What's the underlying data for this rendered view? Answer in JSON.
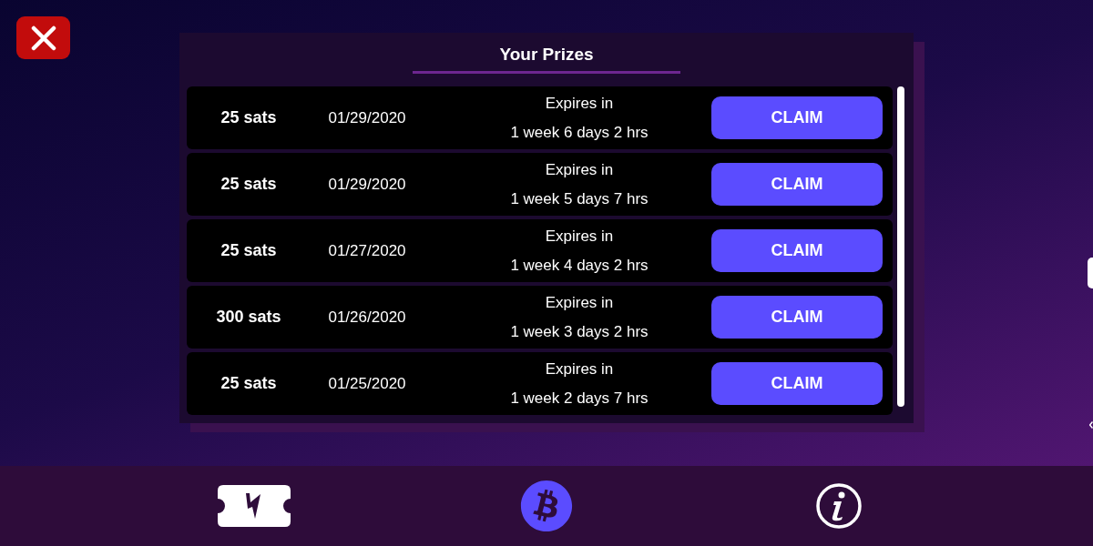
{
  "panel": {
    "title": "Your Prizes"
  },
  "prizes": [
    {
      "amount": "25 sats",
      "date": "01/29/2020",
      "expires_label": "Expires in",
      "expires": "1 week 6 days 2 hrs",
      "button": "CLAIM"
    },
    {
      "amount": "25 sats",
      "date": "01/29/2020",
      "expires_label": "Expires in",
      "expires": "1 week 5 days 7 hrs",
      "button": "CLAIM"
    },
    {
      "amount": "25 sats",
      "date": "01/27/2020",
      "expires_label": "Expires in",
      "expires": "1 week 4 days 2 hrs",
      "button": "CLAIM"
    },
    {
      "amount": "300 sats",
      "date": "01/26/2020",
      "expires_label": "Expires in",
      "expires": "1 week 3 days 2 hrs",
      "button": "CLAIM"
    },
    {
      "amount": "25 sats",
      "date": "01/25/2020",
      "expires_label": "Expires in",
      "expires": "1 week 2 days 7 hrs",
      "button": "CLAIM"
    }
  ],
  "bottom_nav": [
    {
      "kind": "ticket",
      "selected": false
    },
    {
      "kind": "bitcoin",
      "selected": true
    },
    {
      "kind": "info",
      "selected": false
    }
  ]
}
